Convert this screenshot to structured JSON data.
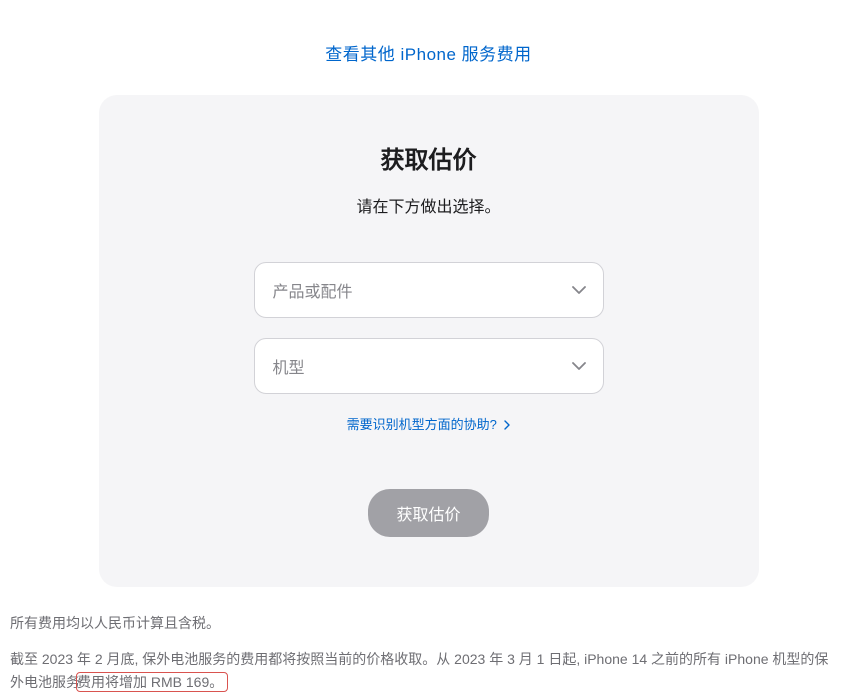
{
  "top_link": {
    "text": "查看其他 iPhone 服务费用"
  },
  "card": {
    "title": "获取估价",
    "subtitle": "请在下方做出选择。",
    "select_product_placeholder": "产品或配件",
    "select_model_placeholder": "机型",
    "help_link_text": "需要识别机型方面的协助?",
    "submit_label": "获取估价"
  },
  "footer": {
    "line1": "所有费用均以人民币计算且含税。",
    "line2_before": "截至 2023 年 2 月底, 保外电池服务的费用都将按照当前的价格收取。从 2023 年 3 月 1 日起, iPhone 14 之前的所有 iPhone 机型的保外电池服务",
    "line2_highlight": "费用将增加 RMB 169。"
  }
}
